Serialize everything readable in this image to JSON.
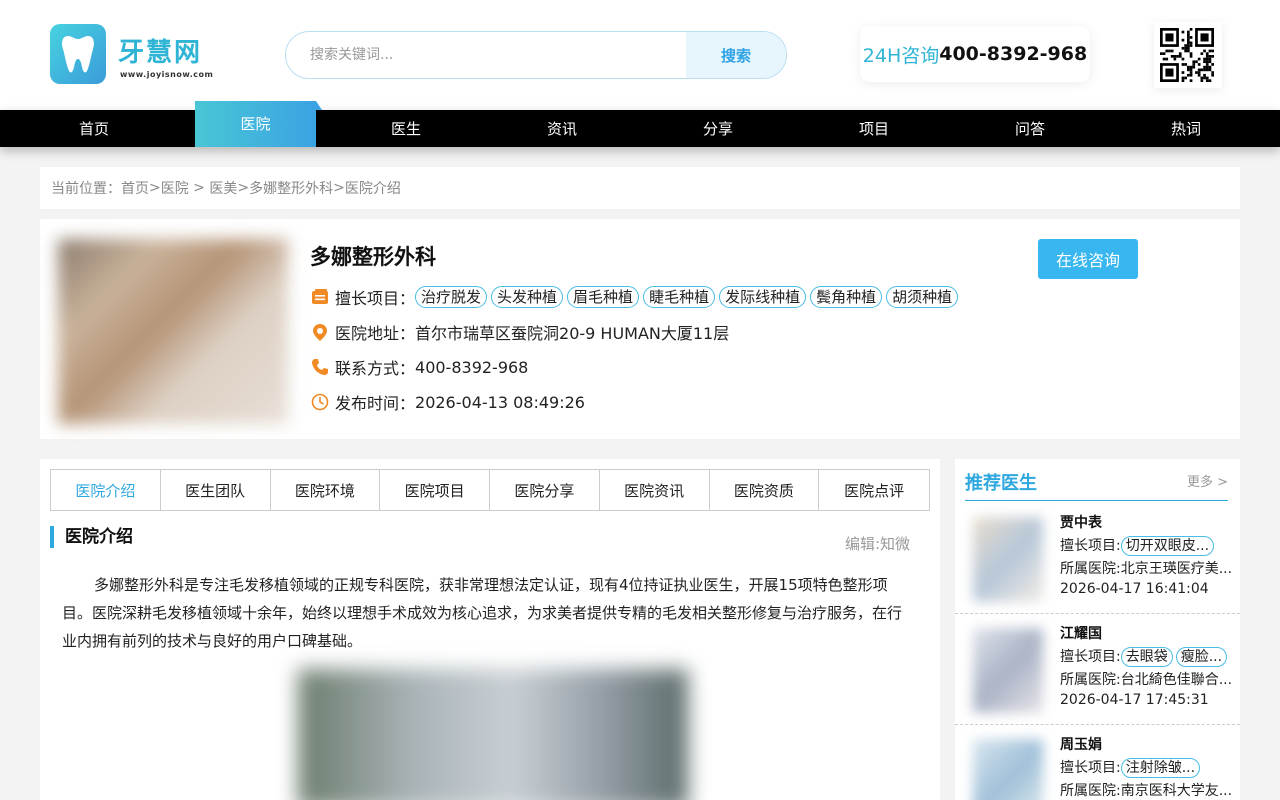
{
  "logo": {
    "name": "牙慧网",
    "url": "www.joyisnow.com"
  },
  "search": {
    "placeholder": "搜索关键词...",
    "button": "搜索"
  },
  "hotline": {
    "label": "24H咨询",
    "number": "400-8392-968"
  },
  "nav": {
    "items": [
      "首页",
      "医院",
      "医生",
      "资讯",
      "分享",
      "项目",
      "问答",
      "热词"
    ],
    "active_index": 1
  },
  "breadcrumb": {
    "prefix": "当前位置：",
    "items": [
      "首页",
      "医院",
      "医美",
      "多娜整形外科",
      "医院介绍"
    ],
    "seps": [
      ">",
      " > ",
      ">",
      ">"
    ]
  },
  "hospital": {
    "name": "多娜整形外科",
    "consult_button": "在线咨询",
    "specialty_label": "擅长项目：",
    "specialties": [
      "治疗脱发",
      "头发种植",
      "眉毛种植",
      "睫毛种植",
      "发际线种植",
      "鬓角种植",
      "胡须种植"
    ],
    "address_label": "医院地址：",
    "address": "首尔市瑞草区蚕院洞20-9 HUMAN大厦11层",
    "contact_label": "联系方式：",
    "contact": "400-8392-968",
    "published_label": "发布时间：",
    "published": "2026-04-13 08:49:26"
  },
  "tabs": {
    "items": [
      "医院介绍",
      "医生团队",
      "医院环境",
      "医院项目",
      "医院分享",
      "医院资讯",
      "医院资质",
      "医院点评"
    ],
    "active_index": 0
  },
  "intro": {
    "title": "医院介绍",
    "editor": "编辑:知微",
    "text": "多娜整形外科是专注毛发移植领域的正规专科医院，获非常理想法定认证，现有4位持证执业医生，开展15项特色整形项目。医院深耕毛发移植领域十余年，始终以理想手术成效为核心追求，为求美者提供专精的毛发相关整形修复与治疗服务，在行业内拥有前列的技术与良好的用户口碑基础。"
  },
  "sidebar": {
    "title": "推荐医生",
    "more": "更多 >",
    "specialty_label": "擅长项目:",
    "hospital_label": "所属医院:",
    "doctors": [
      {
        "name": "贾中表",
        "tags": [
          "切开双眼皮..."
        ],
        "hospital": "北京王瑛医疗美...",
        "date": "2026-04-17 16:41:04"
      },
      {
        "name": "江耀国",
        "tags": [
          "去眼袋",
          "瘦脸..."
        ],
        "hospital": "台北綺色佳聯合...",
        "date": "2026-04-17 17:45:31"
      },
      {
        "name": "周玉娟",
        "tags": [
          "注射除皱..."
        ],
        "hospital": "南京医科大学友...",
        "date": ""
      }
    ]
  },
  "colors": {
    "accent": "#2fa8e0",
    "nav_bg": "#000000",
    "button": "#38b6f0",
    "icon_orange": "#f08a24"
  }
}
